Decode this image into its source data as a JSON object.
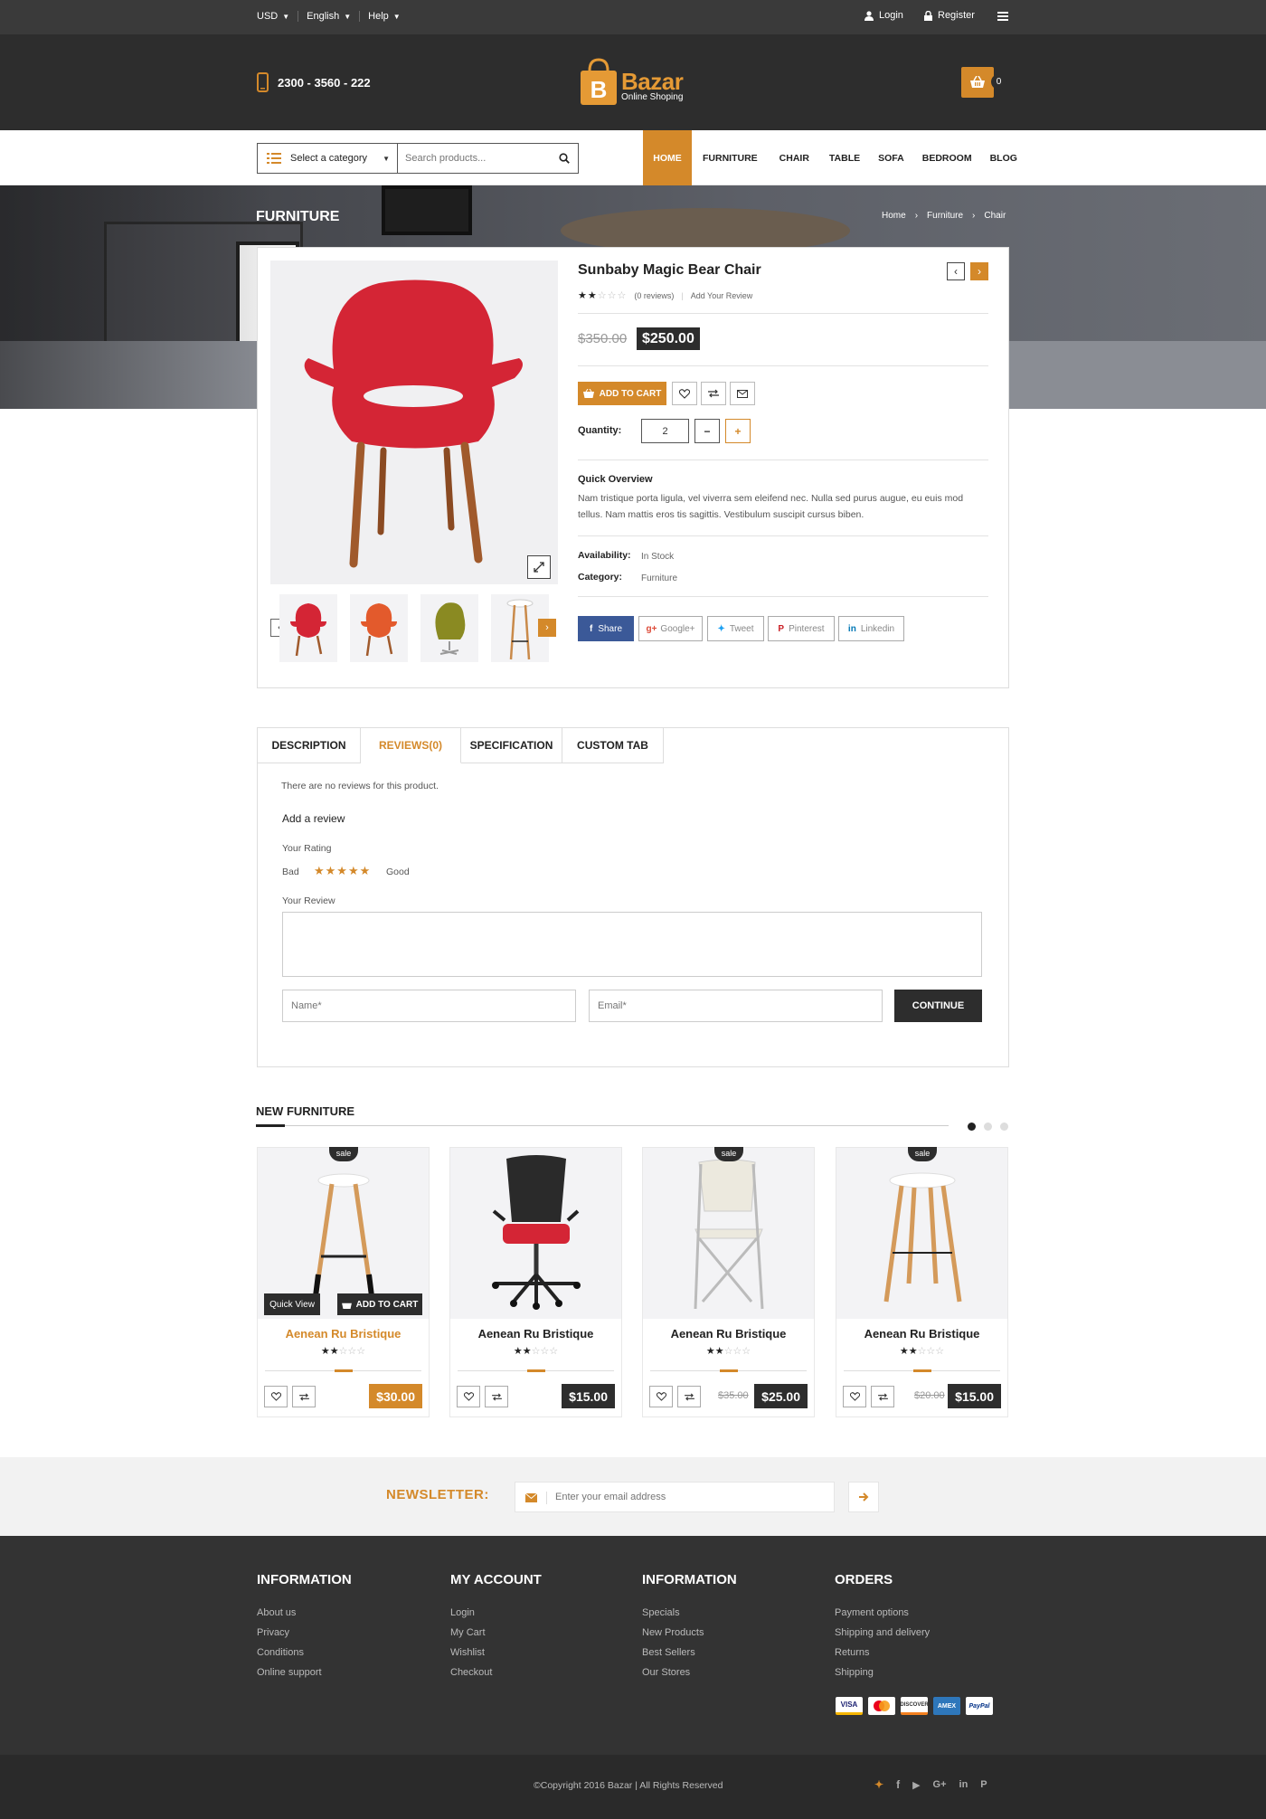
{
  "topbar": {
    "currency": "USD",
    "language": "English",
    "help": "Help",
    "login": "Login",
    "register": "Register"
  },
  "header": {
    "phone": "2300 - 3560 - 222",
    "logo_text": "Bazar",
    "logo_tagline": "Online Shoping",
    "cart_count": "0"
  },
  "search": {
    "category_label": "Select a category",
    "placeholder": "Search products..."
  },
  "nav": {
    "items": [
      "HOME",
      "FURNITURE",
      "CHAIR",
      "TABLE",
      "SOFA",
      "BEDROOM",
      "BLOG"
    ]
  },
  "hero": {
    "title": "FURNITURE",
    "breadcrumb": [
      "Home",
      "Furniture",
      "Chair"
    ]
  },
  "product": {
    "title": "Sunbaby Magic Bear Chair",
    "rating": 2,
    "rating_max": 5,
    "reviews": "(0 reviews)",
    "add_review": "Add Your Review",
    "old_price": "$350.00",
    "price": "$250.00",
    "add_to_cart": "ADD TO CART",
    "quantity_label": "Quantity:",
    "quantity": "2",
    "overview_title": "Quick Overview",
    "overview_text": "Nam tristique porta ligula, vel viverra sem eleifend nec. Nulla sed purus augue, eu euis mod tellus. Nam mattis eros tis sagittis. Vestibulum suscipit cursus biben.",
    "availability_label": "Availability:",
    "availability": "In Stock",
    "category_label": "Category:",
    "category": "Furniture",
    "share": [
      "Share",
      "Google+",
      "Tweet",
      "Pinterest",
      "Linkedin"
    ]
  },
  "tabs": {
    "items": [
      "DESCRIPTION",
      "REVIEWS(0)",
      "SPECIFICATION",
      "CUSTOM TAB"
    ],
    "no_reviews": "There are no reviews for this product.",
    "add_review": "Add a review",
    "your_rating": "Your Rating",
    "bad": "Bad",
    "good": "Good",
    "your_review": "Your Review",
    "name_placeholder": "Name*",
    "email_placeholder": "Email*",
    "continue": "CONTINUE"
  },
  "new_furniture": {
    "title": "NEW FURNITURE",
    "products": [
      {
        "name": "Aenean Ru Bristique",
        "price": "$30.00",
        "old_price": "",
        "sale": "sale",
        "rating": 2,
        "quick_view": "Quick View",
        "add_to_cart": "ADD TO CART"
      },
      {
        "name": "Aenean Ru Bristique",
        "price": "$15.00",
        "old_price": "",
        "sale": "",
        "rating": 2
      },
      {
        "name": "Aenean Ru Bristique",
        "price": "$25.00",
        "old_price": "$35.00",
        "sale": "sale",
        "rating": 2
      },
      {
        "name": "Aenean Ru Bristique",
        "price": "$15.00",
        "old_price": "$20.00",
        "sale": "sale",
        "rating": 2
      }
    ]
  },
  "newsletter": {
    "label": "NEWSLETTER:",
    "placeholder": "Enter your email address"
  },
  "footer": {
    "columns": [
      {
        "title": "INFORMATION",
        "links": [
          "About us",
          "Privacy",
          "Conditions",
          "Online support"
        ]
      },
      {
        "title": "MY ACCOUNT",
        "links": [
          "Login",
          "My Cart",
          "Wishlist",
          "Checkout"
        ]
      },
      {
        "title": "INFORMATION",
        "links": [
          "Specials",
          "New Products",
          "Best Sellers",
          "Our Stores"
        ]
      },
      {
        "title": "ORDERS",
        "links": [
          "Payment options",
          "Shipping and delivery",
          "Returns",
          "Shipping"
        ]
      }
    ],
    "payments": [
      "VISA",
      "MC",
      "DISCOVER",
      "AMEX",
      "PayPal"
    ],
    "copyright": "©Copyright 2016 Bazar | All Rights Reserved"
  },
  "colors": {
    "accent": "#d4892a",
    "dark": "#2d2d2d",
    "topbar": "#3a3a3a"
  }
}
